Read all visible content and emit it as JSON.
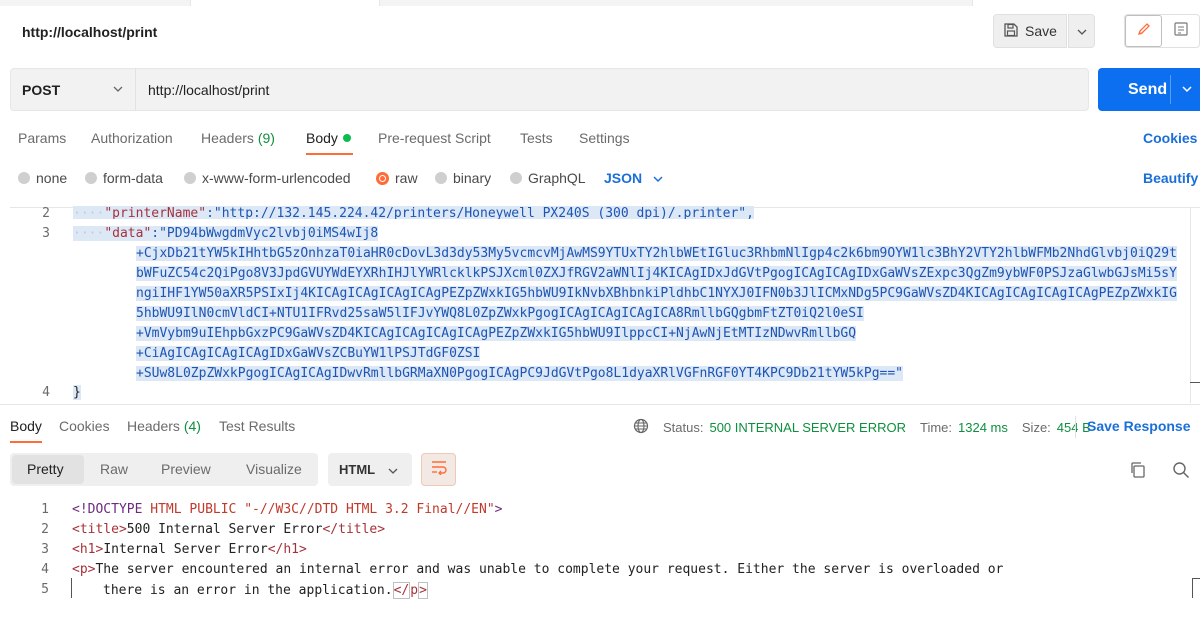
{
  "request": {
    "title": "http://localhost/print",
    "save_label": "Save",
    "method": "POST",
    "url": "http://localhost/print",
    "send_label": "Send"
  },
  "req_tabs": {
    "params": "Params",
    "authorization": "Authorization",
    "headers": "Headers",
    "headers_count": "(9)",
    "body": "Body",
    "prerequest": "Pre-request Script",
    "tests": "Tests",
    "settings": "Settings",
    "cookies": "Cookies"
  },
  "body_types": {
    "none": "none",
    "form_data": "form-data",
    "urlencoded": "x-www-form-urlencoded",
    "raw": "raw",
    "binary": "binary",
    "graphql": "GraphQL",
    "format": "JSON",
    "beautify": "Beautify"
  },
  "request_editor": {
    "line_numbers": [
      "2",
      "3",
      "4"
    ],
    "line2_indent": "····",
    "line2_key": "\"printerName\"",
    "line2_rest": ":\"http://132.145.224.42/printers/Honeywell PX240S (300 dpi)/.printer\",",
    "line3_indent": "····",
    "line3_key": "\"data\"",
    "data_lines": [
      ":\"PD94bWwgdmVyc2lvbj0iMS4wIj8",
      "+CjxDb21tYW5kIHhtbG5zOnhzaT0iaHR0cDovL3d3dy53My5vcmcvMjAwMS9YTUxTY2hlbWEtIGluc3RhbmNlIgp4c2k6bm9OYW1lc3BhY2VTY2hlbWFMb2NhdGlvbj0iQ29t",
      "bWFuZC54c2QiPgo8V3JpdGVUYWdEYXRhIHJlYWRlcklkPSJXcml0ZXJfRGV2aWNlIj4KICAgIDxJdGVtPgogICAgICAgIDxGaWVsZExpc3QgZm9ybWF0PSJzaGlwbGJsMi5sY",
      "ngiIHF1YW50aXR5PSIxIj4KICAgICAgICAgICAgPEZpZWxkIG5hbWU9IkNvbXBhbnkiPldhbC1NYXJ0IFN0b3JlICMxNDg5PC9GaWVsZD4KICAgICAgICAgICAgPEZpZWxkIG",
      "5hbWU9IlN0cmVldCI+NTU1IFRvd25saW5lIFJvYWQ8L0ZpZWxkPgogICAgICAgICAgICA8RmllbGQgbmFtZT0iQ2l0eSI",
      "+VmVybm9uIEhpbGxzPC9GaWVsZD4KICAgICAgICAgICAgPEZpZWxkIG5hbWU9IlppcCI+NjAwNjEtMTIzNDwvRmllbGQ",
      "+CiAgICAgICAgICAgIDxGaWVsZCBuYW1lPSJTdGF0ZSI",
      "+SUw8L0ZpZWxkPgogICAgICAgIDwvRmllbGRMaXN0PgogICAgPC9JdGVtPgo8L1dyaXRlVGFnRGF0YT4KPC9Db21tYW5kPg==\""
    ],
    "line4_text": "}"
  },
  "response": {
    "tabs": {
      "body": "Body",
      "cookies": "Cookies",
      "headers": "Headers",
      "headers_count": "(4)",
      "test_results": "Test Results"
    },
    "status_label": "Status:",
    "status_value": "500 INTERNAL SERVER ERROR",
    "time_label": "Time:",
    "time_value": "1324 ms",
    "size_label": "Size:",
    "size_value": "454 B",
    "save_response": "Save Response",
    "views": {
      "pretty": "Pretty",
      "raw": "Raw",
      "preview": "Preview",
      "visualize": "Visualize",
      "format": "HTML"
    },
    "line_numbers": [
      "1",
      "2",
      "3",
      "4",
      "5"
    ],
    "l1_a": "<!DOCTYPE ",
    "l1_b": "HTML PUBLIC ",
    "l1_c": "\"-//W3C//DTD HTML 3.2 Final//EN\"",
    "l1_d": ">",
    "l2_a": "<title>",
    "l2_b": "500 Internal Server Error",
    "l2_c": "</title>",
    "l3_a": "<h1>",
    "l3_b": "Internal Server Error",
    "l3_c": "</h1>",
    "l4_a": "<p>",
    "l4_b": "The server encountered an internal error and was unable to complete your request. Either the server is overloaded or",
    "l5_a": "there is an error in the application.",
    "l5_b": "</",
    "l5_c": "p",
    "l5_d": ">"
  },
  "icons": {
    "save": "floppy-icon",
    "edit": "pencil-icon",
    "comments": "comment-icon",
    "globe": "globe-icon",
    "copy": "copy-icon",
    "search": "search-icon",
    "wrap": "wrap-lines-icon"
  },
  "colors": {
    "accent": "#ff6c37",
    "send": "#0c6ff0",
    "link": "#1a6fd8",
    "success": "#0e8f3e"
  }
}
